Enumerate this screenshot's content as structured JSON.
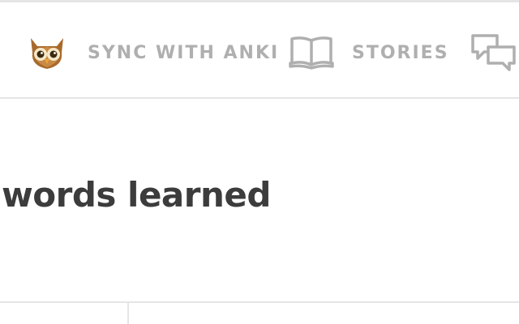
{
  "nav": {
    "items": [
      {
        "label": "SYNC WITH ANKI",
        "icon": "owl-icon"
      },
      {
        "label": "STORIES",
        "icon": "book-icon"
      },
      {
        "label": "",
        "icon": "chat-bubbles-icon"
      }
    ]
  },
  "main": {
    "heading": "words learned"
  },
  "colors": {
    "nav_text": "#afafaf",
    "heading_text": "#3c3c3c",
    "divider": "#e5e5e5"
  }
}
